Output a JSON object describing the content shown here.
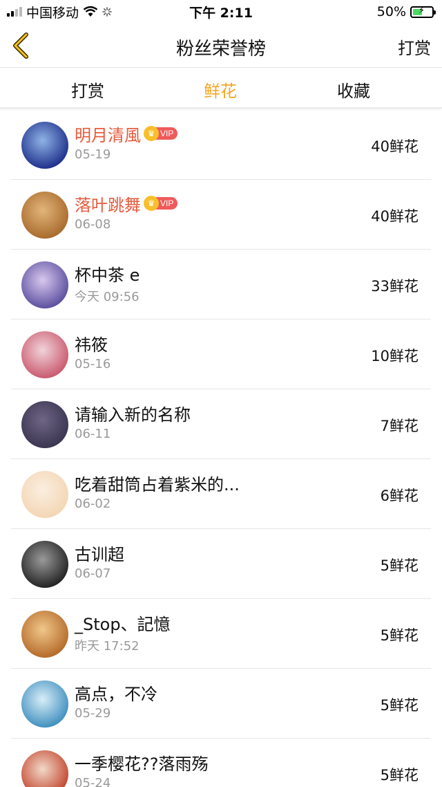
{
  "status": {
    "carrier": "中国移动",
    "time": "下午 2:11",
    "battery": "50%",
    "battery_level": 0.5
  },
  "nav": {
    "back_icon": "chevron-left-icon",
    "title": "粉丝荣誉榜",
    "right_label": "打赏"
  },
  "tabs": [
    {
      "label": "打赏",
      "active": false
    },
    {
      "label": "鲜花",
      "active": true
    },
    {
      "label": "收藏",
      "active": false
    }
  ],
  "colors": {
    "accent": "#f5a623",
    "vip_name": "#e85a3c",
    "vip_tag": "#ef5a5a",
    "crown": "#f7c02a"
  },
  "list": [
    {
      "name": "明月清風",
      "vip": true,
      "vip_label": "VIP",
      "time": "05-19",
      "count": "40鲜花",
      "avatar_colors": [
        "#1e2f8a",
        "#8fb3e6"
      ]
    },
    {
      "name": "落叶跳舞",
      "vip": true,
      "vip_label": "VIP",
      "time": "06-08",
      "count": "40鲜花",
      "avatar_colors": [
        "#a86a2c",
        "#e2b57a"
      ]
    },
    {
      "name": "杯中茶 e",
      "vip": false,
      "time": "今天 09:56",
      "count": "33鲜花",
      "avatar_colors": [
        "#5b4f9e",
        "#d8c7ee"
      ]
    },
    {
      "name": "祎筱",
      "vip": false,
      "time": "05-16",
      "count": "10鲜花",
      "avatar_colors": [
        "#c9596d",
        "#f1d3da"
      ]
    },
    {
      "name": "请输入新的名称",
      "vip": false,
      "time": "06-11",
      "count": "7鲜花",
      "avatar_colors": [
        "#3a3550",
        "#6f6585"
      ]
    },
    {
      "name": "吃着甜筒占着紫米的...",
      "vip": false,
      "time": "06-02",
      "count": "6鲜花",
      "avatar_colors": [
        "#f3d6b4",
        "#fbeee0"
      ]
    },
    {
      "name": "古训超",
      "vip": false,
      "time": "06-07",
      "count": "5鲜花",
      "avatar_colors": [
        "#222222",
        "#9a9a9a"
      ]
    },
    {
      "name": "_Stop、記憶",
      "vip": false,
      "time": "昨天 17:52",
      "count": "5鲜花",
      "avatar_colors": [
        "#b46a2a",
        "#f0c78a"
      ]
    },
    {
      "name": "高点，不冷",
      "vip": false,
      "time": "05-29",
      "count": "5鲜花",
      "avatar_colors": [
        "#3f8fbf",
        "#d9eef7"
      ]
    },
    {
      "name": "一季樱花??落雨殇",
      "vip": false,
      "time": "05-24",
      "count": "5鲜花",
      "avatar_colors": [
        "#c2452f",
        "#f2d9c8"
      ]
    }
  ]
}
